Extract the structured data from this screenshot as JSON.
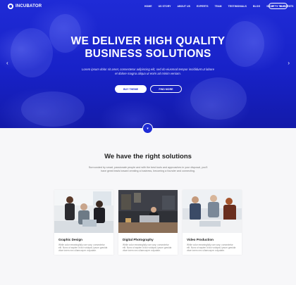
{
  "brand": {
    "name": "INCUBATOR"
  },
  "nav": {
    "items": [
      "HOME",
      "US STORY",
      "ABOUT US",
      "EXPERTS",
      "TEAM",
      "TESTIMONIALS",
      "BLOG",
      "SHOP",
      "ELEMENTS"
    ],
    "cta_label": "LET'S TALK"
  },
  "hero": {
    "title_line1": "WE DELIVER HIGH QUALITY",
    "title_line2": "BUSINESS SOLUTIONS",
    "subtitle_line1": "Lorem ipsum dolor sit amet, consectetur adipiscing elit, sed do eiusmod tempor incididunt ut labore",
    "subtitle_line2": "et dolore magna aliqua ut enim ad minim veniam.",
    "primary_button": "BUY THEME",
    "secondary_button": "FIND MORE",
    "prev_icon": "chevron-left-icon",
    "next_icon": "chevron-right-icon",
    "scroll_icon": "chevron-down-icon"
  },
  "solutions": {
    "title": "We have the right solutions",
    "text_line1": "Surrounded by smart, passionate people and with the best tools and approaches in your disposal, you'll",
    "text_line2": "have great leads toward creating a business, becoming a founder and connecting.",
    "cards": [
      {
        "title": "Graphic Design",
        "text1": "While color meaningfully can vary; consectetur",
        "text2": "elit. Nunc ut sapien id dui volutpat, ipsum gravida",
        "text3": "vitae lorem nec ullamcorper vulputate."
      },
      {
        "title": "Digital Photography",
        "text1": "While color meaningfully can vary; consectetur",
        "text2": "elit. Nunc ut sapien id dui volutpat, ipsum gravida",
        "text3": "vitae lorem nec ullamcorper vulputate."
      },
      {
        "title": "Video Production",
        "text1": "While color meaningfully can vary; consectetur",
        "text2": "elit. Nunc ut sapien id dui volutpat, ipsum gravida",
        "text3": "vitae lorem nec ullamcorper vulputate."
      }
    ]
  },
  "colors": {
    "accent": "#1f2bd6",
    "section_bg": "#f7f7f9",
    "white": "#ffffff"
  }
}
